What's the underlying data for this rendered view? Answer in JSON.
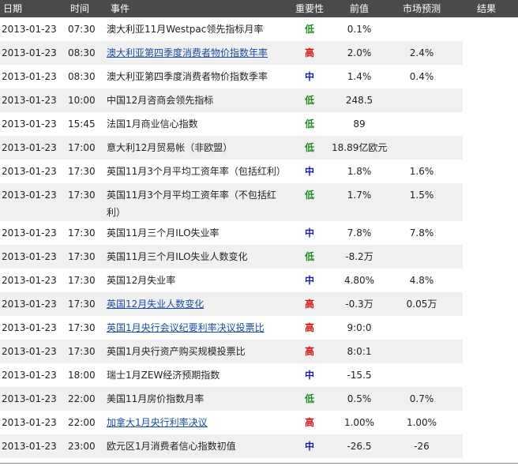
{
  "header": {
    "date": "日期",
    "time": "时间",
    "event": "事件",
    "importance": "重要性",
    "previous": "前值",
    "forecast": "市场预测",
    "result": "结果"
  },
  "rows": [
    {
      "date": "2013-01-23",
      "time": "07:30",
      "event": "澳大利亚11月Westpac领先指标月率",
      "link": false,
      "importance": "低",
      "imp": "low",
      "previous": "0.1%",
      "forecast": ""
    },
    {
      "date": "2013-01-23",
      "time": "08:30",
      "event": "澳大利亚第四季度消费者物价指数年率",
      "link": true,
      "importance": "高",
      "imp": "high",
      "previous": "2.0%",
      "forecast": "2.4%"
    },
    {
      "date": "2013-01-23",
      "time": "08:30",
      "event": "澳大利亚第四季度消费者物价指数季率",
      "link": false,
      "importance": "中",
      "imp": "mid",
      "previous": "1.4%",
      "forecast": "0.4%"
    },
    {
      "date": "2013-01-23",
      "time": "10:00",
      "event": "中国12月咨商会领先指标",
      "link": false,
      "importance": "低",
      "imp": "low",
      "previous": "248.5",
      "forecast": ""
    },
    {
      "date": "2013-01-23",
      "time": "15:45",
      "event": "法国1月商业信心指数",
      "link": false,
      "importance": "低",
      "imp": "low",
      "previous": "89",
      "forecast": ""
    },
    {
      "date": "2013-01-23",
      "time": "17:00",
      "event": "意大利12月贸易帐（非欧盟）",
      "link": false,
      "importance": "低",
      "imp": "low",
      "previous": "18.89亿欧元",
      "forecast": ""
    },
    {
      "date": "2013-01-23",
      "time": "17:30",
      "event": "英国11月3个月平均工资年率（包括红利）",
      "link": false,
      "importance": "中",
      "imp": "mid",
      "previous": "1.8%",
      "forecast": "1.6%"
    },
    {
      "date": "2013-01-23",
      "time": "17:30",
      "event": "英国11月3个月平均工资年率（不包括红利）",
      "link": false,
      "importance": "低",
      "imp": "low",
      "previous": "1.7%",
      "forecast": "1.5%",
      "tall": true
    },
    {
      "date": "2013-01-23",
      "time": "17:30",
      "event": "英国11月三个月ILO失业率",
      "link": false,
      "importance": "中",
      "imp": "mid",
      "previous": "7.8%",
      "forecast": "7.8%"
    },
    {
      "date": "2013-01-23",
      "time": "17:30",
      "event": "英国11月三个月ILO失业人数变化",
      "link": false,
      "importance": "低",
      "imp": "low",
      "previous": "-8.2万",
      "forecast": ""
    },
    {
      "date": "2013-01-23",
      "time": "17:30",
      "event": "英国12月失业率",
      "link": false,
      "importance": "中",
      "imp": "mid",
      "previous": "4.80%",
      "forecast": "4.8%"
    },
    {
      "date": "2013-01-23",
      "time": "17:30",
      "event": "英国12月失业人数变化",
      "link": true,
      "importance": "高",
      "imp": "high",
      "previous": "-0.3万",
      "forecast": "0.05万"
    },
    {
      "date": "2013-01-23",
      "time": "17:30",
      "event": "英国1月央行会议纪要利率决议投票比",
      "link": true,
      "importance": "高",
      "imp": "high",
      "previous": "9:0:0",
      "forecast": ""
    },
    {
      "date": "2013-01-23",
      "time": "17:30",
      "event": "英国1月央行资产购买规模投票比",
      "link": false,
      "importance": "高",
      "imp": "high",
      "previous": "8:0:1",
      "forecast": ""
    },
    {
      "date": "2013-01-23",
      "time": "18:00",
      "event": "瑞士1月ZEW经济预期指数",
      "link": false,
      "importance": "中",
      "imp": "mid",
      "previous": "-15.5",
      "forecast": ""
    },
    {
      "date": "2013-01-23",
      "time": "22:00",
      "event": "美国11月房价指数月率",
      "link": false,
      "importance": "低",
      "imp": "low",
      "previous": "0.5%",
      "forecast": "0.7%"
    },
    {
      "date": "2013-01-23",
      "time": "22:00",
      "event": "加拿大1月央行利率决议",
      "link": true,
      "importance": "高",
      "imp": "high",
      "previous": "1.00%",
      "forecast": "1.00%"
    },
    {
      "date": "2013-01-23",
      "time": "23:00",
      "event": "欧元区1月消费者信心指数初值",
      "link": false,
      "importance": "中",
      "imp": "mid",
      "previous": "-26.5",
      "forecast": "-26"
    }
  ]
}
